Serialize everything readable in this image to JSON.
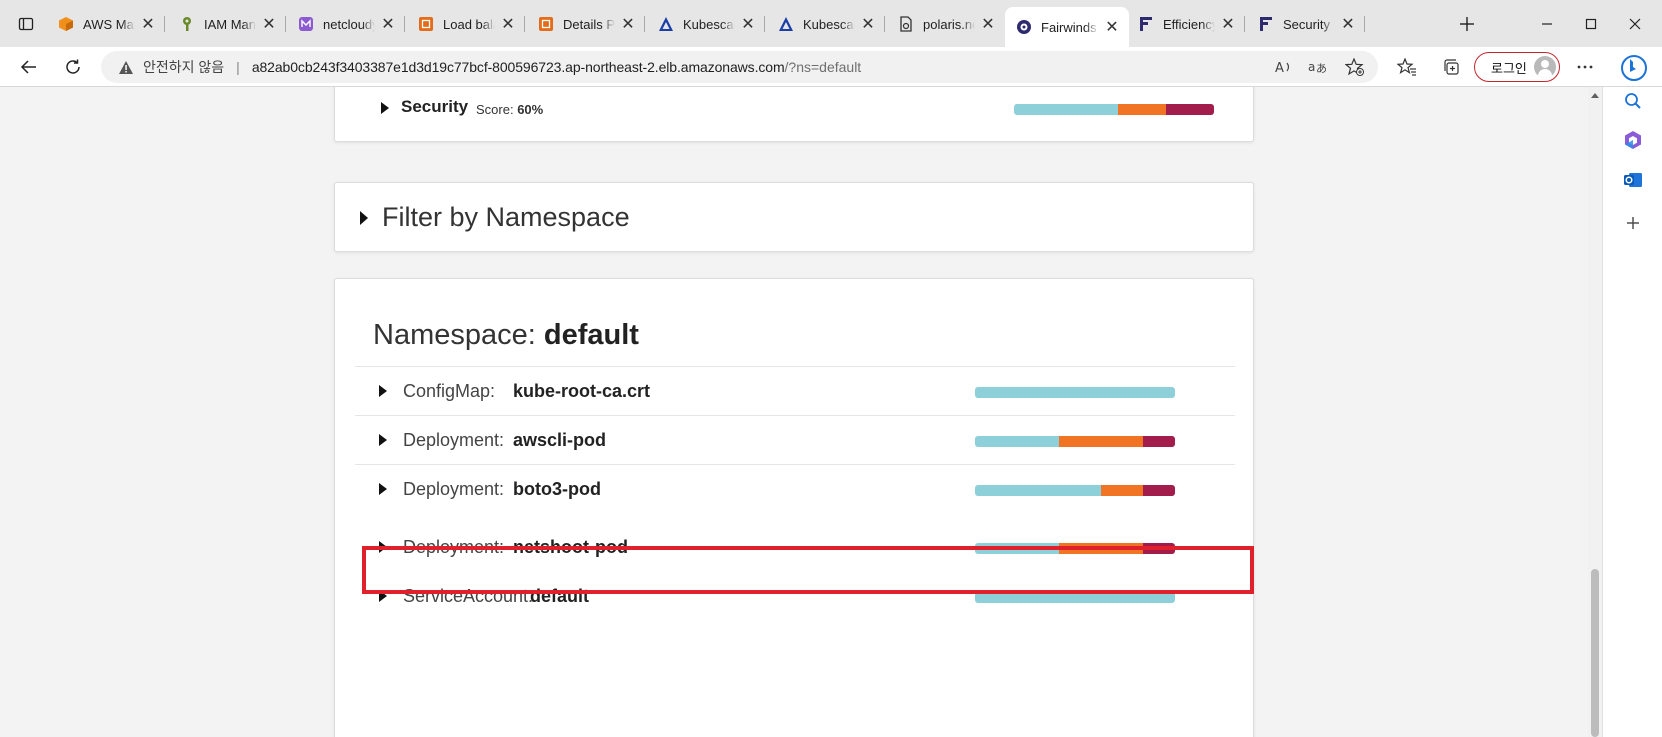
{
  "tabs": [
    {
      "title": "AWS Management Console",
      "icon": "aws-cube-icon",
      "color": "#f08f1a"
    },
    {
      "title": "IAM Management Console",
      "icon": "iam-icon",
      "color": "#6a8a2a"
    },
    {
      "title": "netcloudy.io",
      "icon": "netcloudy-icon",
      "color": "#8d5bd1"
    },
    {
      "title": "Load balancers",
      "icon": "ec2-icon",
      "color": "#e36d1a"
    },
    {
      "title": "Details Page",
      "icon": "ec2-icon",
      "color": "#e36d1a"
    },
    {
      "title": "Kubescape",
      "icon": "kubescape-icon",
      "color": "#1b3ea8"
    },
    {
      "title": "Kubescape",
      "icon": "kubescape-icon",
      "color": "#1b3ea8"
    },
    {
      "title": "polaris.netcloudy.io",
      "icon": "document-icon",
      "color": "#333333"
    },
    {
      "title": "Fairwinds Polaris",
      "icon": "polaris-icon",
      "color": "#2d2a6e",
      "active": true
    },
    {
      "title": "Efficiency | Fairwinds",
      "icon": "fairwinds-icon",
      "color": "#2d2a6e"
    },
    {
      "title": "Security | Fairwinds",
      "icon": "fairwinds-icon",
      "color": "#2d2a6e"
    }
  ],
  "address": {
    "insecure_label": "안전하지 않음",
    "host": "a82ab0cb243f3403387e1d3d19c77bcf-800596723.ap-northeast-2.elb.amazonaws.com",
    "path": "/?ns=default"
  },
  "login_label": "로그인",
  "security": {
    "title": "Security",
    "score_label": "Score:",
    "score_value": "60%",
    "bar": [
      0.52,
      0.24,
      0.24
    ]
  },
  "filter": {
    "label": "Filter by Namespace"
  },
  "namespace": {
    "heading_prefix": "Namespace:",
    "name": "default",
    "rows": [
      {
        "kind": "ConfigMap:",
        "name": "kube-root-ca.crt",
        "bar": [
          1.0,
          0,
          0
        ]
      },
      {
        "kind": "Deployment:",
        "name": "awscli-pod",
        "bar": [
          0.42,
          0.42,
          0.16
        ]
      },
      {
        "kind": "Deployment:",
        "name": "boto3-pod",
        "bar": [
          0.63,
          0.21,
          0.16
        ]
      },
      {
        "kind": "Deployment:",
        "name": "netshoot-pod",
        "bar": [
          0.42,
          0.42,
          0.16
        ],
        "highlighted": true
      },
      {
        "kind": "ServiceAccount:",
        "name": "default",
        "bar": [
          1.0,
          0,
          0
        ]
      }
    ]
  },
  "colors": {
    "passing": "#8dd0da",
    "warning": "#f07424",
    "danger": "#a21d4c",
    "highlight": "#e0202a"
  }
}
